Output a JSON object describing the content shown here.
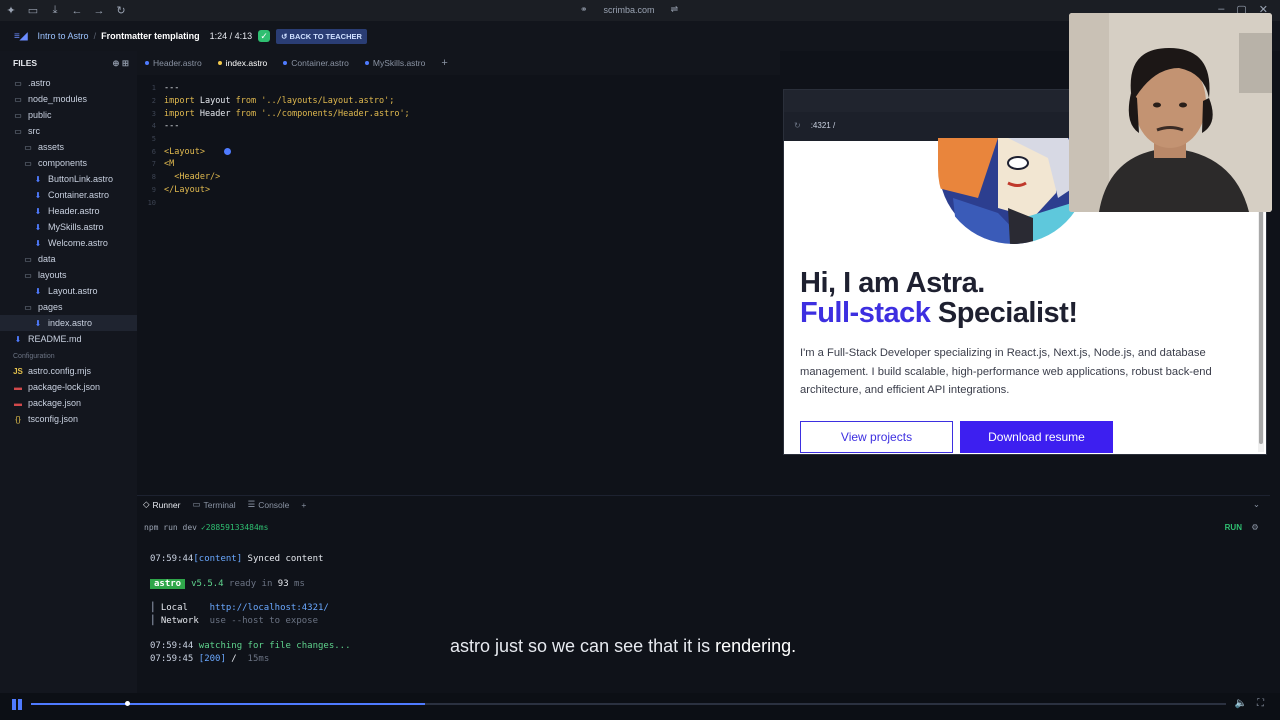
{
  "chrome": {
    "url": "scrimba.com"
  },
  "topbar": {
    "course": "Intro to Astro",
    "lesson": "Frontmatter templating",
    "time_current": "1:24",
    "time_total": "4:13",
    "back_label": "BACK TO TEACHER"
  },
  "sidebar": {
    "header": "FILES",
    "items": [
      {
        "label": ".astro",
        "type": "folder",
        "depth": 0
      },
      {
        "label": "node_modules",
        "type": "folder",
        "depth": 0
      },
      {
        "label": "public",
        "type": "folder",
        "depth": 0
      },
      {
        "label": "src",
        "type": "folder",
        "depth": 0
      },
      {
        "label": "assets",
        "type": "folder",
        "depth": 1
      },
      {
        "label": "components",
        "type": "folder",
        "depth": 1
      },
      {
        "label": "ButtonLink.astro",
        "type": "astro",
        "depth": 2
      },
      {
        "label": "Container.astro",
        "type": "astro",
        "depth": 2
      },
      {
        "label": "Header.astro",
        "type": "astro",
        "depth": 2
      },
      {
        "label": "MySkills.astro",
        "type": "astro",
        "depth": 2
      },
      {
        "label": "Welcome.astro",
        "type": "astro",
        "depth": 2
      },
      {
        "label": "data",
        "type": "folder",
        "depth": 1
      },
      {
        "label": "layouts",
        "type": "folder",
        "depth": 1
      },
      {
        "label": "Layout.astro",
        "type": "astro",
        "depth": 2
      },
      {
        "label": "pages",
        "type": "folder",
        "depth": 1
      },
      {
        "label": "index.astro",
        "type": "astro",
        "depth": 2,
        "active": true
      },
      {
        "label": "README.md",
        "type": "md",
        "depth": 0
      }
    ],
    "config_header": "Configuration",
    "config_items": [
      {
        "label": "astro.config.mjs",
        "icon": "JS"
      },
      {
        "label": "package-lock.json",
        "icon": "pkg"
      },
      {
        "label": "package.json",
        "icon": "pkg"
      },
      {
        "label": "tsconfig.json",
        "icon": "{}"
      }
    ]
  },
  "tabs": [
    {
      "label": "Header.astro",
      "active": false
    },
    {
      "label": "index.astro",
      "active": true
    },
    {
      "label": "Container.astro",
      "active": false
    },
    {
      "label": "MySkills.astro",
      "active": false
    }
  ],
  "editor": {
    "line_numbers": [
      "1",
      "2",
      "3",
      "4",
      "5",
      "6",
      "7",
      "8",
      "9",
      "10"
    ],
    "l1": "---",
    "l2_kw": "import",
    "l2_name": " Layout ",
    "l2_from": "from",
    "l2_str": " '../layouts/Layout.astro';",
    "l3_kw": "import",
    "l3_name": " Header ",
    "l3_from": "from",
    "l3_str": " '../components/Header.astro';",
    "l4": "---",
    "l6": "<Layout>",
    "l7": "<M",
    "l8": "  <Header/>",
    "l9": "</Layout>"
  },
  "preview": {
    "address": ":4321 /",
    "heading_line1": "Hi, I am Astra.",
    "heading_accent": "Full-stack",
    "heading_rest": " Specialist!",
    "bio": "I'm a Full-Stack Developer specializing in React.js, Next.js, Node.js, and database management. I build scalable, high-performance web applications, robust back-end architecture, and efficient API integrations.",
    "btn_projects": "View projects",
    "btn_resume": "Download resume"
  },
  "panel": {
    "tabs": [
      "Runner",
      "Terminal",
      "Console"
    ],
    "command": "npm run dev",
    "status": "✓28859133484ms",
    "run_label": "RUN"
  },
  "terminal": {
    "t1_time": "07:59:44",
    "t1_tag": "[content]",
    "t1_msg": " Synced content",
    "badge": "astro",
    "version": "v5.5.4",
    "ready": " ready in ",
    "ready_ms": "93",
    "ms": " ms",
    "local_label": "Local",
    "local_url": "http://localhost:4321/",
    "network_label": "Network",
    "network_msg": "use --host to expose",
    "t5_time": "07:59:44",
    "t5_msg": " watching for file changes...",
    "t6_time": "07:59:45",
    "t6_code": " [200]",
    "t6_path": " / ",
    "t6_ms": " 15ms"
  },
  "caption": {
    "text": "astro just so we can see that it is ",
    "highlight": "rendering."
  },
  "player": {
    "progress": 0.33,
    "buffered": 0.08
  },
  "colors": {
    "accent": "#4f7bff",
    "brand_purple": "#3d2fe0",
    "success": "#2fbf71"
  }
}
